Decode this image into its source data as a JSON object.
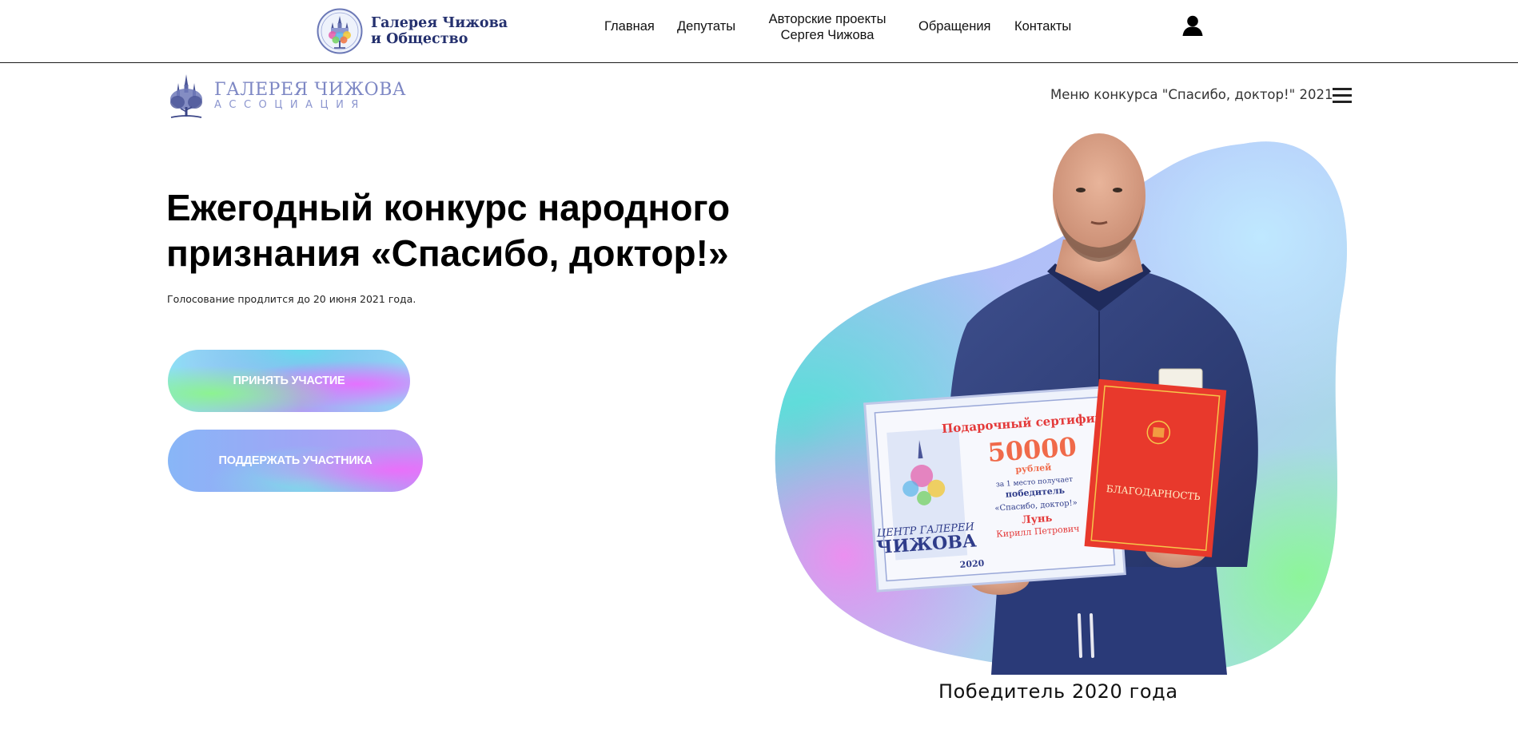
{
  "header": {
    "brand": {
      "line1": "Галерея Чижова",
      "line2": "и Общество"
    },
    "nav": [
      {
        "label": "Главная"
      },
      {
        "label": "Депутаты"
      },
      {
        "label_line1": "Авторские проекты",
        "label_line2": "Сергея Чижова"
      },
      {
        "label": "Обращения"
      },
      {
        "label": "Контакты"
      }
    ],
    "user_icon": "user-icon"
  },
  "subheader": {
    "logo": {
      "title": "ГАЛЕРЕЯ ЧИЖОВА",
      "subtitle": "АССОЦИАЦИЯ"
    },
    "menu_label": "Меню конкурса \"Спасибо, доктор!\" 2021",
    "menu_icon": "hamburger-menu-icon"
  },
  "hero": {
    "title_line1": "Ежегодный конкурс народного",
    "title_line2": "признания «Спасибо, доктор!»",
    "subtitle": "Голосование продлится до 20 июня 2021 года.",
    "buttons": [
      {
        "label": "ПРИНЯТЬ УЧАСТИЕ"
      },
      {
        "label": "ПОДДЕРЖАТЬ УЧАСТНИКА"
      }
    ]
  },
  "winner": {
    "caption": "Победитель 2020 года",
    "certificate": {
      "heading": "Подарочный сертификат",
      "amount": "50000",
      "currency": "рублей",
      "place_line": "за 1 место получает",
      "winner_label": "победитель",
      "contest": "«Спасибо, доктор!»",
      "name_surname": "Лунь",
      "name_given": "Кирилл Петрович",
      "logo_line1": "ЦЕНТР ГАЛЕРЕИ",
      "logo_line2": "ЧИЖОВА",
      "year": "2020"
    },
    "diploma": {
      "heading": "БЛАГОДАРНОСТЬ"
    }
  },
  "colors": {
    "brand_blue": "#24306e",
    "assoc_blue": "#7d87c4",
    "gradient_green": "#8cf58c",
    "gradient_pink": "#e86eff",
    "gradient_cyan": "#5fe1eb",
    "diploma_red": "#e8392c"
  }
}
